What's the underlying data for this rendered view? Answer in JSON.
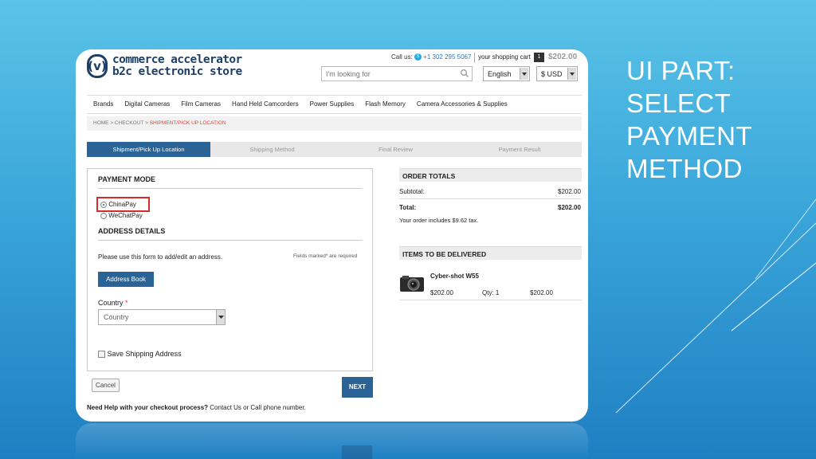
{
  "slide": {
    "title_lines": [
      "UI PART:",
      "SELECT",
      "PAYMENT",
      "METHOD"
    ]
  },
  "header": {
    "logo_mark": "(v)",
    "logo_line1": "commerce accelerator",
    "logo_line2": "b2c electronic store",
    "call_label": "Call us:",
    "phone": "+1 302 295 5067",
    "cart_label": "your shopping cart",
    "cart_count": "1",
    "cart_total": "$202.00",
    "search_placeholder": "I'm looking for",
    "language": "English",
    "currency": "$ USD"
  },
  "nav": {
    "items": [
      "Brands",
      "Digital Cameras",
      "Film Cameras",
      "Hand Held Camcorders",
      "Power Supplies",
      "Flash Memory",
      "Camera Accessories & Supplies"
    ]
  },
  "breadcrumb": {
    "home": "HOME",
    "sep": ">",
    "checkout": "CHECKOUT",
    "current": "SHIPMENT/PICK UP LOCATION"
  },
  "steps": [
    "Shipment/Pick Up Location",
    "Shipping Method",
    "Final Review",
    "Payment Result"
  ],
  "payment": {
    "title": "PAYMENT MODE",
    "options": [
      "ChinaPay",
      "WeChatPay"
    ],
    "selected": "ChinaPay"
  },
  "address": {
    "title": "ADDRESS DETAILS",
    "instruction": "Please use this form to add/edit an address.",
    "required_note": "Fields marked* are required",
    "address_book_label": "Address Book",
    "country_label": "Country",
    "required_star": "*",
    "country_placeholder": "Country",
    "save_shipping_label": "Save Shipping Address"
  },
  "actions": {
    "cancel_label": "Cancel",
    "next_label": "NEXT"
  },
  "help": {
    "bold": "Need Help with your checkout process?",
    "rest": " Contact Us or Call phone number."
  },
  "order_totals": {
    "title": "ORDER TOTALS",
    "subtotal_label": "Subtotal:",
    "subtotal_value": "$202.00",
    "total_label": "Total:",
    "total_value": "$202.00",
    "tax_note": "Your order includes $9.62 tax."
  },
  "delivery": {
    "title": "ITEMS TO BE DELIVERED",
    "item_name": "Cyber-shot W55",
    "item_price": "$202.00",
    "item_qty": "Qty: 1",
    "item_total": "$202.00"
  },
  "colors": {
    "accent": "#2a6496",
    "highlight": "#d52b2b",
    "background_top": "#5ac3e8",
    "background_bottom": "#1f7fc2"
  }
}
